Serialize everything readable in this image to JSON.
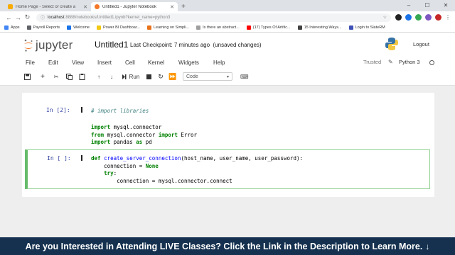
{
  "browser": {
    "tabs": [
      {
        "title": "Home Page - Select or create a",
        "active": false,
        "color": "#f9ab00"
      },
      {
        "title": "Untitled1 - Jupyter Notebook",
        "active": true,
        "color": "#f37726"
      }
    ],
    "new_tab": "+",
    "url_host": "localhost",
    "url_path": ":8888/notebooks/Untitled1.ipynb?kernel_name=python3",
    "bookmarks": [
      {
        "label": "Apps",
        "color": "#4285f4"
      },
      {
        "label": "Payroll Reports",
        "color": "#5f6368"
      },
      {
        "label": "Welcome",
        "color": "#1a73e8"
      },
      {
        "label": "Power BI Dashboar...",
        "color": "#f2c811"
      },
      {
        "label": "Learning on Simpli...",
        "color": "#e8711a"
      },
      {
        "label": "Is there an abstract...",
        "color": "#9e9e9e"
      },
      {
        "label": "(17) Types Of Artific...",
        "color": "#ff0000"
      },
      {
        "label": "15 Interesting Ways...",
        "color": "#424242"
      },
      {
        "label": "Login to SlateRM",
        "color": "#3f51b5"
      }
    ]
  },
  "jupyter": {
    "logo_text": "jupyter",
    "notebook_title": "Untitled1",
    "checkpoint": "Last Checkpoint: 7 minutes ago",
    "unsaved": "(unsaved changes)",
    "logout": "Logout",
    "menu": [
      "File",
      "Edit",
      "View",
      "Insert",
      "Cell",
      "Kernel",
      "Widgets",
      "Help"
    ],
    "trusted": "Trusted",
    "kernel_name": "Python 3",
    "run_label": "Run",
    "cell_type": "Code"
  },
  "cells": [
    {
      "prompt": "In [2]:",
      "lines": [
        "# import libraries",
        "",
        "import mysql.connector",
        "from mysql.connector import Error",
        "import pandas as pd"
      ]
    },
    {
      "prompt": "In [ ]:",
      "lines": [
        "def create_server_connection(host_name, user_name, user_password):",
        "    connection = None",
        "    try:",
        "        connection = mysql.connector.connect"
      ]
    }
  ],
  "banner": {
    "text": "Are you Interested in Attending LIVE Classes? Click the Link in the Description to Learn More.",
    "arrow": "↓",
    "color": "#15314f"
  }
}
